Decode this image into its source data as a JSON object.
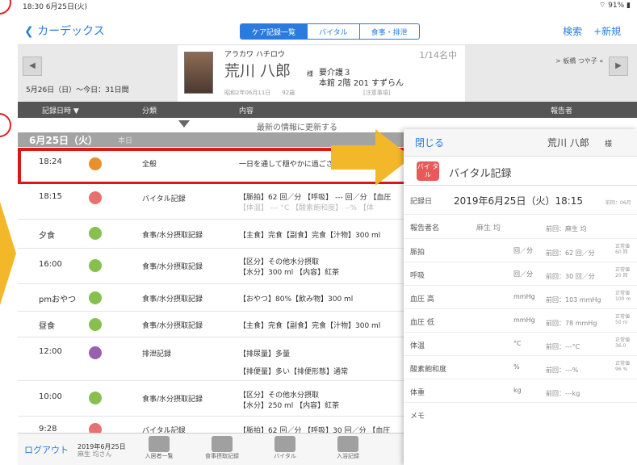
{
  "status": {
    "time": "18:30 6月25日(火)",
    "battery": "91%"
  },
  "nav": {
    "back": "カーデックス",
    "tabs": [
      "ケア記録一覧",
      "バイタル",
      "食事・排泄"
    ],
    "search": "検索",
    "new": "+新規"
  },
  "patient": {
    "range": "5月26日（日）～今日：31日間",
    "kana": "アラカワ ハチロウ",
    "name": "荒川 八郎",
    "sama": "様",
    "birth": "昭和2年06月11日",
    "age": "92歳",
    "count": "1/14名中",
    "care_level": "要介護３",
    "room": "本館 2階 201 すずらん",
    "note": "[注意事項]",
    "next": "> 板橋 つや子 «"
  },
  "table_header": {
    "datetime": "記録日時 ▼",
    "category": "分類",
    "content": "内容",
    "reporter": "報告者"
  },
  "refresh_text": "最新の情報に更新する",
  "date_group": {
    "date": "6月25日（火）",
    "label": "本日"
  },
  "rows": [
    {
      "time": "18:24",
      "dot": "#e8902a",
      "category": "全般",
      "line1": "一日を通して穏やかに過ごされ",
      "line2": ""
    },
    {
      "time": "18:15",
      "dot": "#e87070",
      "category": "バイタル記録",
      "line1": "【脈拍】62 回／分 【呼吸】 --- 回／分 【血圧",
      "line2": "【体温】 --- °C 【酸素飽和度】 --% 【体"
    },
    {
      "time": "夕食",
      "dot": "#88c050",
      "category": "食事/水分摂取記録",
      "line1": "【主食】完食【副食】完食【汁物】300 ml",
      "line2": ""
    },
    {
      "time": "16:00",
      "dot": "#88c050",
      "category": "食事/水分摂取記録",
      "line1": "【区分】その他水分摂取",
      "line2": "【水分】300 ml 【内容】紅茶"
    },
    {
      "time": "pmおやつ",
      "dot": "#88c050",
      "category": "食事/水分摂取記録",
      "line1": "【おやつ】80%【飲み物】300 ml",
      "line2": ""
    },
    {
      "time": "昼食",
      "dot": "#88c050",
      "category": "食事/水分摂取記録",
      "line1": "【主食】完食【副食】完食【汁物】300 ml",
      "line2": ""
    },
    {
      "time": "12:00",
      "dot": "#9a60b0",
      "category": "排泄記録",
      "line1": "【排尿量】多量",
      "line2": "【排便量】多い【排便形態】通常"
    },
    {
      "time": "10:00",
      "dot": "#88c050",
      "category": "食事/水分摂取記録",
      "line1": "【区分】その他水分摂取",
      "line2": "【水分】250 ml 【内容】紅茶"
    },
    {
      "time": "9:28",
      "dot": "#e87070",
      "category": "バイタル記録",
      "line1": "【脈拍】62 回／分 【呼吸】30 回／分 【血圧",
      "line2": ""
    }
  ],
  "bottom": {
    "logout": "ログアウト",
    "date": "2019年6月25日",
    "user": "麻生 均さん",
    "tabs": [
      "入居者一覧",
      "食事摂取記録",
      "バイタル",
      "入浴記録"
    ]
  },
  "panel": {
    "close": "閉じる",
    "name": "荒川 八郎",
    "sama": "様",
    "badge": "バイ タル",
    "title": "バイタル記録",
    "record_date_label": "記録日",
    "record_date": "2019年6月25日（火）18:15",
    "prev_ref": "前回：06月",
    "reporter_label": "報告者名",
    "reporter": "麻生 均",
    "prev_reporter": "前回：麻生 均",
    "items": [
      {
        "label": "脈拍",
        "unit": "回／分",
        "prev": "前回：62 回／分",
        "ref": "正常値 60 回"
      },
      {
        "label": "呼吸",
        "unit": "回／分",
        "prev": "前回：30 回／分",
        "ref": "正常値 20 回"
      },
      {
        "label": "血圧 高",
        "unit": "mmHg",
        "prev": "前回：103 mmHg",
        "ref": "正常値 100 m"
      },
      {
        "label": "血圧 低",
        "unit": "mmHg",
        "prev": "前回：78 mmHg",
        "ref": "正常値 50 m"
      },
      {
        "label": "体温",
        "unit": "°C",
        "prev": "前回：---°C",
        "ref": "正常値 36.0"
      },
      {
        "label": "酸素飽和度",
        "unit": "%",
        "prev": "前回：---%",
        "ref": "正常値 96 %"
      },
      {
        "label": "体重",
        "unit": "kg",
        "prev": "前回：---kg",
        "ref": ""
      },
      {
        "label": "メモ",
        "unit": "",
        "prev": "",
        "ref": ""
      }
    ]
  }
}
